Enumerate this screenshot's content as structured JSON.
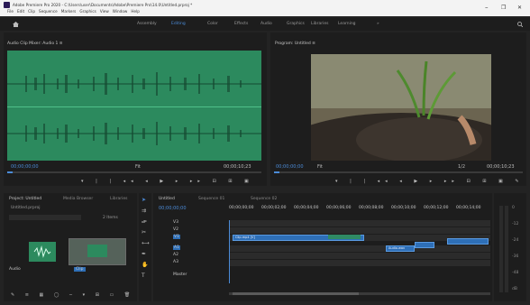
{
  "window": {
    "title": "Adobe Premiere Pro 2020 - C:\\Users\\user\\Documents\\Adobe\\Premiere Pro\\14.0\\Untitled.prproj *",
    "menu": [
      "File",
      "Edit",
      "Clip",
      "Sequence",
      "Markers",
      "Graphics",
      "View",
      "Window",
      "Help"
    ],
    "controls": [
      "–",
      "❐",
      "✕"
    ]
  },
  "workspaces": {
    "home_icon": "home-icon",
    "items": [
      "Assembly",
      "Editing",
      "Color",
      "Effects",
      "Audio",
      "Graphics",
      "Libraries",
      "Learning"
    ],
    "active_index": 1,
    "more": "»",
    "search_icon": "search-icon"
  },
  "source_monitor": {
    "tab": "Audio Clip Mixer: Audio 1  ≡",
    "timecode_left": "00;00;00;00",
    "zoom": "Fit",
    "timecode_right": "00;00;10;23",
    "progress": 0.02
  },
  "program_monitor": {
    "tab": "Program: Untitled  ≡",
    "timecode_left": "00;00;00;00",
    "fit_label": "Fit",
    "quality": "1/2",
    "timecode_right": "00;00;10;23",
    "progress": 0.02
  },
  "project_panel": {
    "tabs": [
      "Project: Untitled",
      "Media Browser",
      "Libraries"
    ],
    "path": "Untitled.prproj",
    "item_count": "2 Items",
    "items": [
      {
        "name": "Audio",
        "thumb": "audio-thumb"
      },
      {
        "name": "Clip",
        "thumb": "video-thumb"
      }
    ]
  },
  "timeline": {
    "tabs": [
      "Untitled",
      "Sequence 01",
      "Sequence 02"
    ],
    "timecode": "00;00;00;00",
    "ruler": [
      "00;00;00;00",
      "00;00;02;00",
      "00;00;04;00",
      "00;00;06;00",
      "00;00;08;00",
      "00;00;10;00",
      "00;00;12;00",
      "00;00;14;00",
      "00;00;16;00",
      "00;00;18;00"
    ],
    "clips": [
      {
        "label": "Clip.mp4 [V]",
        "track": "V1"
      },
      {
        "label": "Audio.wav",
        "track": "A1"
      }
    ],
    "track_labels": [
      "V3",
      "V2",
      "V1",
      "A1",
      "A2",
      "A3",
      "Master"
    ]
  },
  "audio_meter": {
    "scale": [
      "0",
      "-12",
      "-24",
      "-36",
      "-48",
      "dB"
    ]
  },
  "tools": [
    "selection-icon",
    "track-select-icon",
    "ripple-edit-icon",
    "razor-icon",
    "slip-icon",
    "pen-icon",
    "hand-icon",
    "type-icon"
  ],
  "colors": {
    "accent": "#4b8bd8",
    "waveform_bg": "#2c8a5e",
    "clip_blue": "#2e6fb7"
  }
}
